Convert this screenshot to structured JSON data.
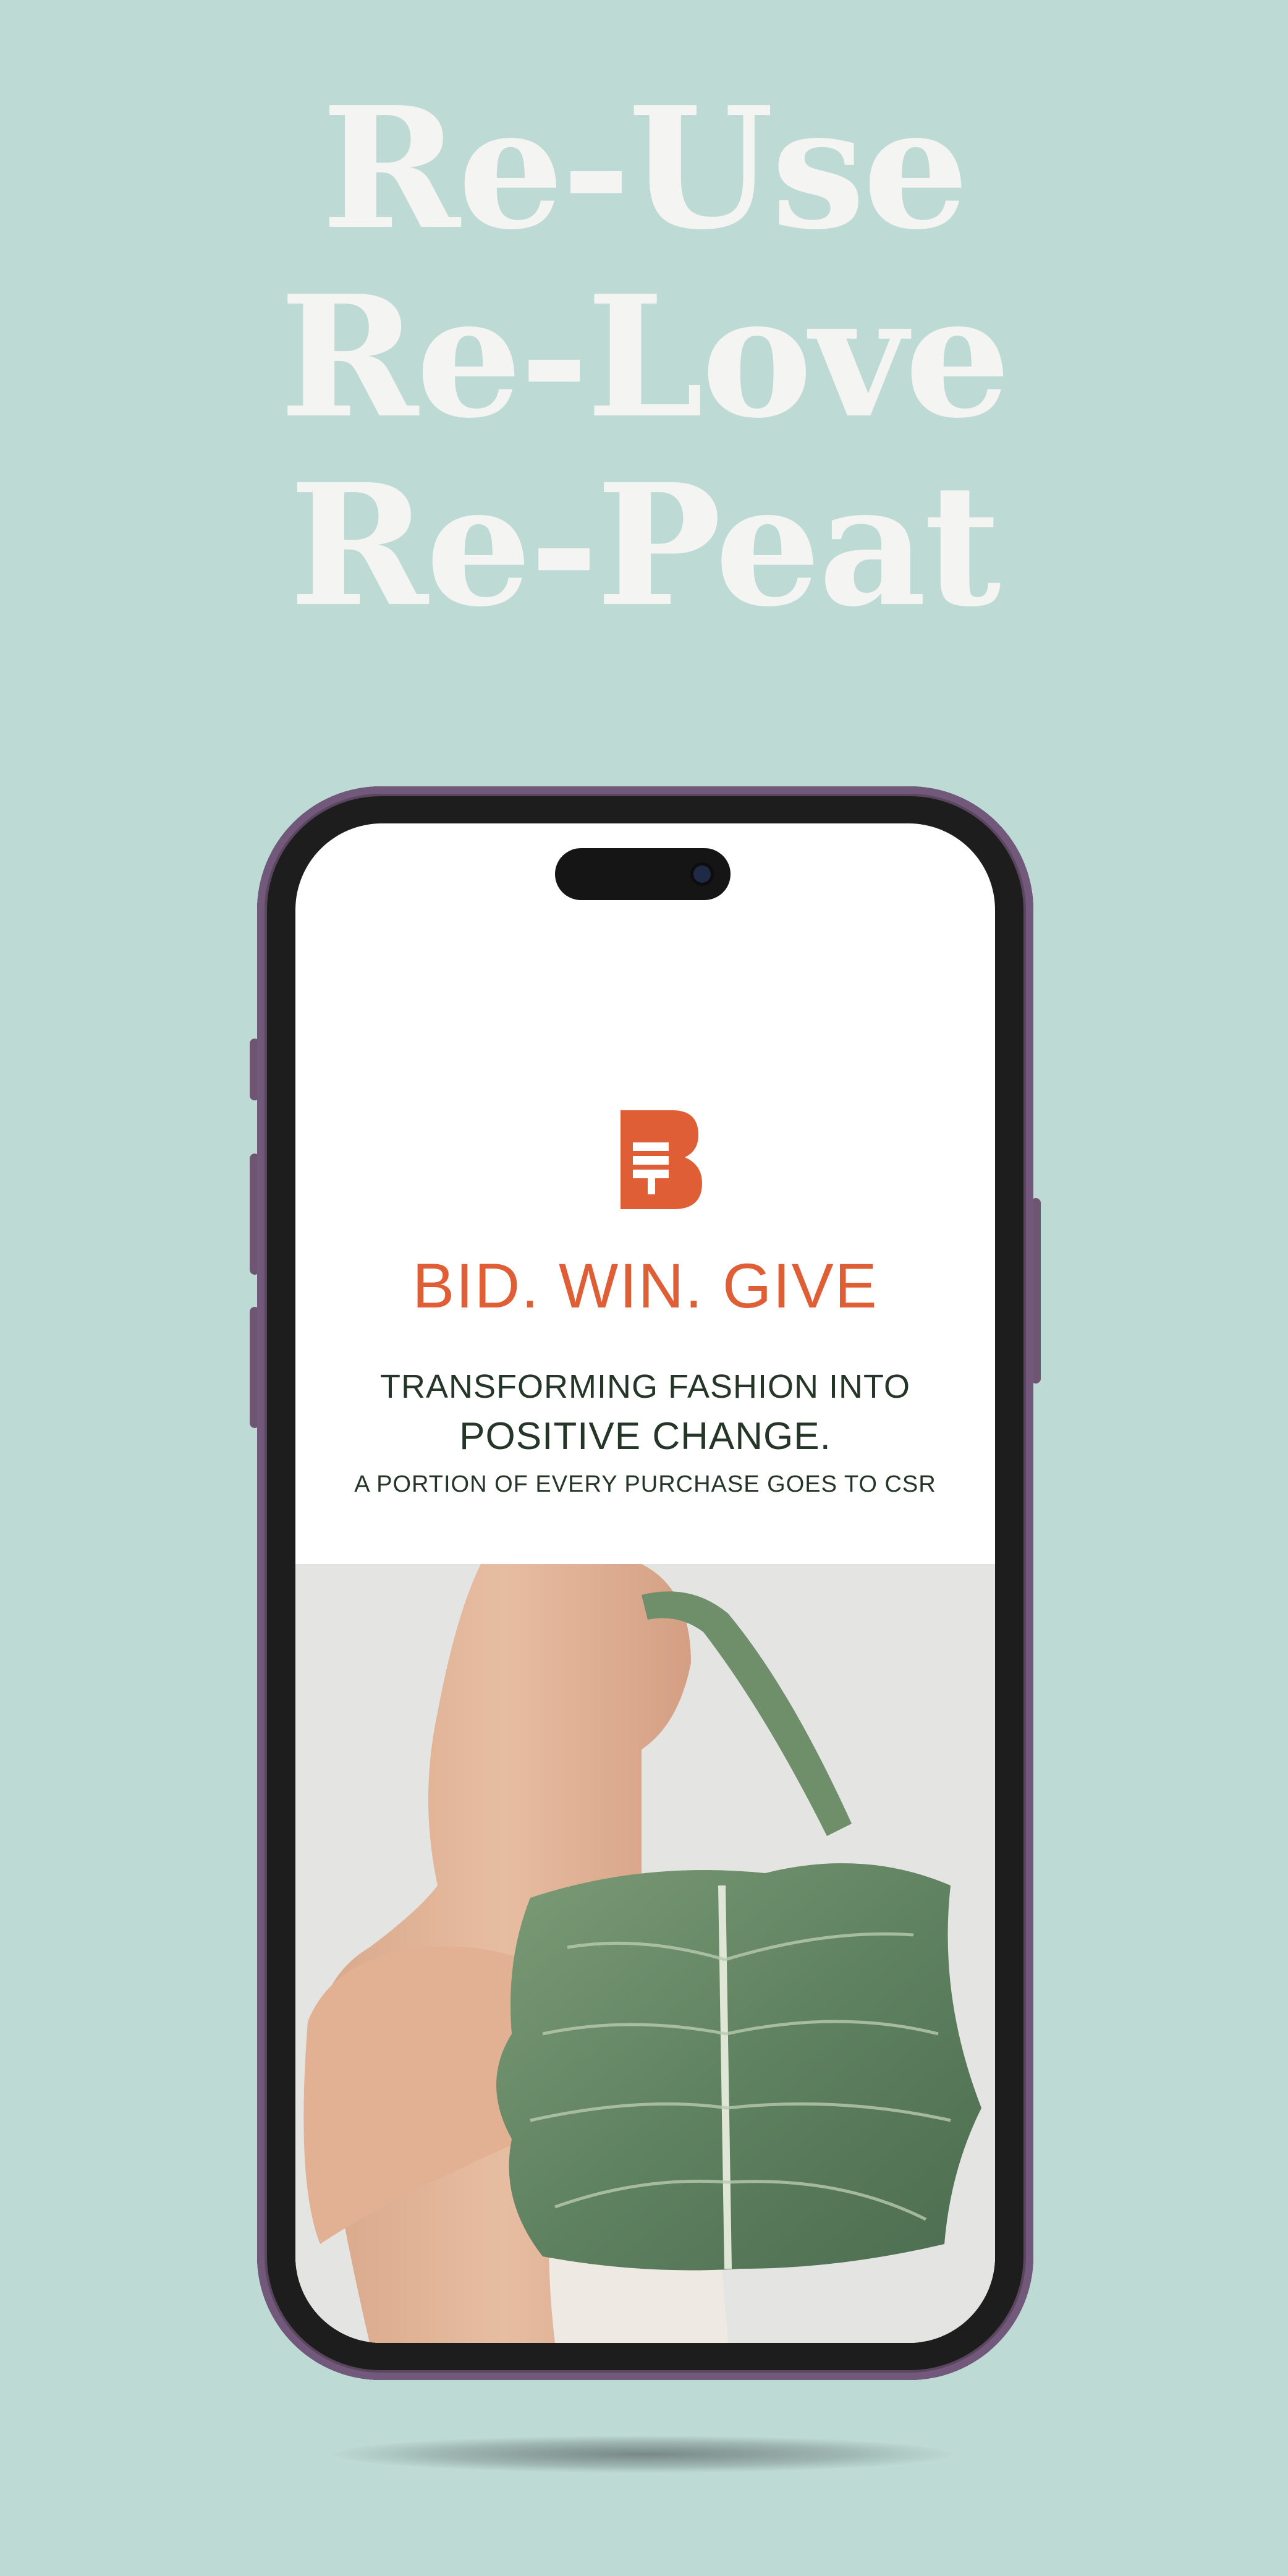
{
  "headline": {
    "line1": "Re-Use",
    "line2": "Re-Love",
    "line3": "Re-Peat"
  },
  "screen": {
    "logo_icon": "gavel-b-logo-icon",
    "tagline": "BID. WIN. GIVE",
    "subtitle_line1": "TRANSFORMING FASHION INTO",
    "subtitle_line2": "POSITIVE CHANGE.",
    "subtitle_line3": "A PORTION OF EVERY PURCHASE GOES TO CSR"
  },
  "colors": {
    "background": "#bedad5",
    "accent": "#e05e36",
    "text_dark": "#253628",
    "phone_frame": "#72587a"
  }
}
